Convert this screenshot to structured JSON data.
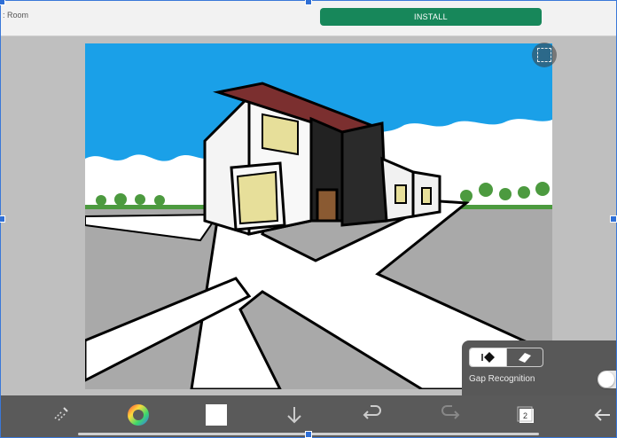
{
  "topbar": {
    "room_label": ": Room",
    "install_label": "INSTALL"
  },
  "canvas": {
    "scene": "line-art house drawing",
    "colors": {
      "sky": "#1aa0e8",
      "ground": "#a9a9a9",
      "roof": "#7b2f2f",
      "door": "#8a5a32",
      "window": "#e7df9a",
      "trees": "#4c9a3f"
    }
  },
  "canvas_tools": {
    "selection_icon": "selection-icon"
  },
  "fill_panel": {
    "fill_icon": "fill-bucket-icon",
    "eraser_icon": "eraser-icon",
    "gap_label": "Gap Recognition",
    "gap_enabled": false
  },
  "toolbar": {
    "tools": [
      "transform-icon",
      "color-wheel-icon",
      "layer-color-swatch",
      "down-arrow-icon",
      "undo-icon",
      "redo-icon",
      "layers-icon",
      "back-icon"
    ],
    "layer_count": "2",
    "swatch_color": "#ffffff"
  },
  "theme": {
    "accent": "#17875a",
    "selection_blue": "#2f6fd6"
  }
}
